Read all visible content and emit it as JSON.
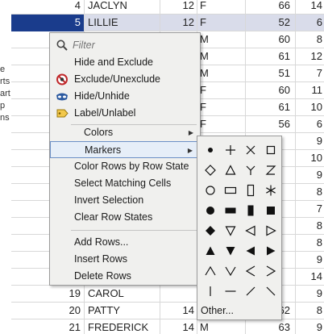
{
  "left_strip": {
    "lines": [
      "e",
      "rts",
      "art",
      "p",
      "ns"
    ]
  },
  "table": {
    "rows": [
      {
        "row": "4",
        "name": "JACLYN",
        "age": "12",
        "sex": "F",
        "height": "66",
        "weight": "14"
      },
      {
        "row": "5",
        "name": "LILLIE",
        "age": "12",
        "sex": "F",
        "height": "52",
        "weight": "6"
      },
      {
        "row": "",
        "name": "",
        "age": "",
        "sex": "M",
        "height": "60",
        "weight": "8"
      },
      {
        "row": "",
        "name": "",
        "age": "",
        "sex": "M",
        "height": "61",
        "weight": "12"
      },
      {
        "row": "",
        "name": "",
        "age": "",
        "sex": "M",
        "height": "51",
        "weight": "7"
      },
      {
        "row": "",
        "name": "",
        "age": "",
        "sex": "F",
        "height": "60",
        "weight": "11"
      },
      {
        "row": "",
        "name": "",
        "age": "",
        "sex": "F",
        "height": "61",
        "weight": "10"
      },
      {
        "row": "",
        "name": "",
        "age": "",
        "sex": "F",
        "height": "56",
        "weight": "6"
      },
      {
        "row": "",
        "name": "",
        "age": "",
        "sex": "",
        "height": "",
        "weight": "9"
      },
      {
        "row": "",
        "name": "",
        "age": "",
        "sex": "",
        "height": "",
        "weight": "10"
      },
      {
        "row": "",
        "name": "",
        "age": "",
        "sex": "",
        "height": "",
        "weight": "9"
      },
      {
        "row": "",
        "name": "",
        "age": "",
        "sex": "",
        "height": "",
        "weight": "8"
      },
      {
        "row": "",
        "name": "",
        "age": "",
        "sex": "",
        "height": "",
        "weight": "7"
      },
      {
        "row": "",
        "name": "",
        "age": "",
        "sex": "",
        "height": "",
        "weight": "8"
      },
      {
        "row": "",
        "name": "",
        "age": "",
        "sex": "",
        "height": "",
        "weight": "8"
      },
      {
        "row": "",
        "name": "",
        "age": "",
        "sex": "",
        "height": "",
        "weight": "9"
      },
      {
        "row": "",
        "name": "",
        "age": "",
        "sex": "",
        "height": "",
        "weight": "14"
      },
      {
        "row": "19",
        "name": "CAROL",
        "age": "",
        "sex": "",
        "height": "",
        "weight": "9"
      },
      {
        "row": "20",
        "name": "PATTY",
        "age": "14",
        "sex": "F",
        "height": "62",
        "weight": "8"
      },
      {
        "row": "21",
        "name": "FREDERICK",
        "age": "14",
        "sex": "M",
        "height": "63",
        "weight": "9"
      }
    ]
  },
  "context_menu": {
    "filter_placeholder": "Filter",
    "items": {
      "hide_exclude": "Hide and Exclude",
      "exclude": "Exclude/Unexclude",
      "hide": "Hide/Unhide",
      "label": "Label/Unlabel",
      "colors": "Colors",
      "markers": "Markers",
      "color_rows": "Color Rows by Row State",
      "select_matching": "Select Matching Cells",
      "invert": "Invert Selection",
      "clear_states": "Clear Row States",
      "add_rows": "Add Rows...",
      "insert_rows": "Insert Rows",
      "delete_rows": "Delete Rows"
    }
  },
  "markers_submenu": {
    "other_label": "Other...",
    "markers": [
      "dot",
      "plus",
      "x-cross",
      "square-open",
      "diamond-open",
      "triangle-open",
      "y-shape",
      "z-shape",
      "circle-open",
      "rect-wide-open",
      "rect-tall-open",
      "asterisk",
      "circle-filled",
      "rect-wide-filled",
      "rect-tall-filled",
      "square-filled",
      "diamond-filled",
      "triangle-down-open",
      "triangle-left-open",
      "triangle-right-open",
      "triangle-up-filled",
      "triangle-down-filled",
      "triangle-left-filled",
      "triangle-right-filled",
      "caret-up",
      "caret-down",
      "caret-left",
      "caret-right",
      "vertical-line",
      "horizontal-line",
      "slash",
      "backslash"
    ]
  },
  "colors": {
    "selection_row_header": "#1a3c8c",
    "selection_row": "#d9dcea",
    "menu_background": "#f0f0ee",
    "highlight_border": "#6b8fc6"
  }
}
